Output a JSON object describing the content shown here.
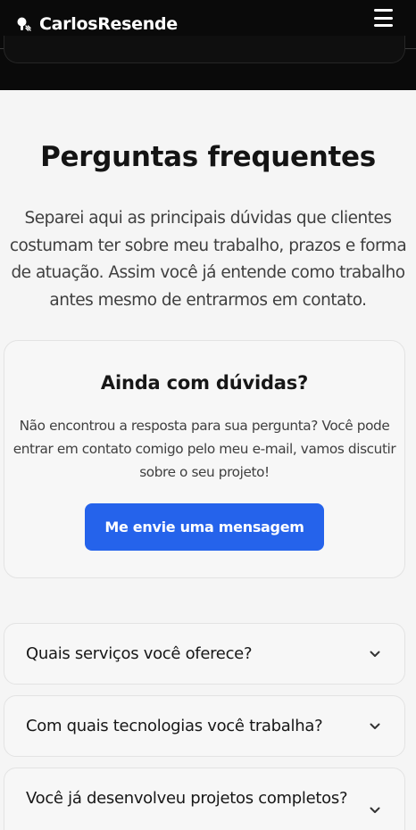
{
  "header": {
    "brand_name": "CarlosResende",
    "brand_icon": "paint-brush-icon",
    "menu_icon": "hamburger-menu-icon"
  },
  "faq_section": {
    "title": "Perguntas frequentes",
    "intro": "Separei aqui as principais dúvidas que clientes costumam ter sobre meu trabalho, prazos e forma de atuação. Assim você já entende como trabalho antes mesmo de entrarmos em contato."
  },
  "contact_card": {
    "title": "Ainda com dúvidas?",
    "description": "Não encontrou a resposta para sua pergunta? Você pode entrar em contato comigo pelo meu e-mail, vamos discutir sobre o seu projeto!",
    "button_label": "Me envie uma mensagem"
  },
  "faq_items": [
    {
      "question": "Quais serviços você oferece?",
      "icon": "chevron-down-icon"
    },
    {
      "question": "Com quais tecnologias você trabalha?",
      "icon": "chevron-down-icon"
    },
    {
      "question": "Você já desenvolveu projetos completos?",
      "icon": "chevron-down-icon"
    }
  ],
  "colors": {
    "header_bg": "#0a0a0a",
    "page_bg": "#f5f5f5",
    "accent": "#2563eb"
  }
}
